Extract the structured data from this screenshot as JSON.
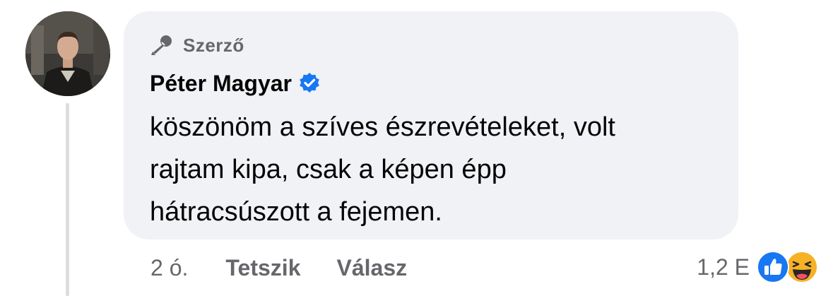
{
  "comment": {
    "badge_label": "Szerző",
    "badge_icon": "microphone-icon",
    "author_name": "Péter Magyar",
    "verified": true,
    "verified_color": "#1877f2",
    "text_lines": [
      "köszönöm a szíves észrevételeket, volt",
      "rajtam kipa, csak a képen épp",
      "hátracsúszott a fejemen."
    ]
  },
  "actions": {
    "timestamp": "2 ó.",
    "like_label": "Tetszik",
    "reply_label": "Válasz"
  },
  "reactions": {
    "count": "1,2 E",
    "types": [
      "like",
      "haha"
    ],
    "icons": [
      "like-reaction-icon",
      "haha-reaction-icon"
    ]
  },
  "colors": {
    "bubble_background": "#f0f2f5",
    "secondary_text": "#65676b",
    "primary_text": "#050505",
    "accent": "#1877f2"
  }
}
